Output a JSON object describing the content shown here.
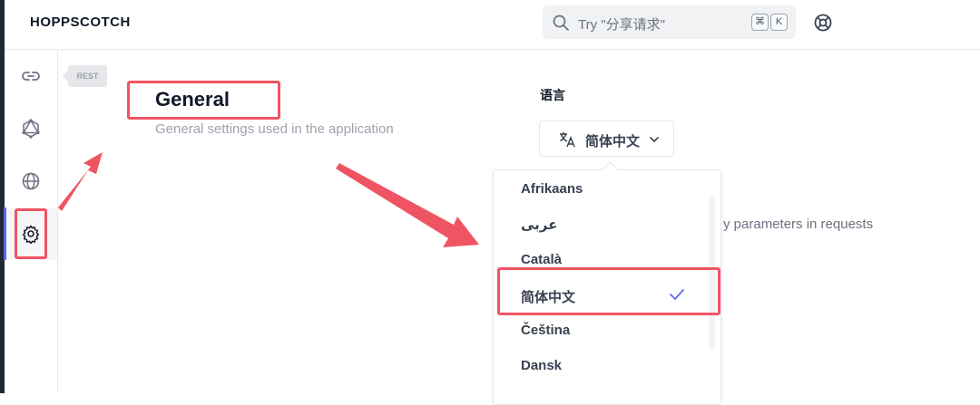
{
  "app": {
    "brand": "HOPPSCOTCH"
  },
  "search": {
    "placeholder": "Try \"分享请求\"",
    "shortcut_key1": "⌘",
    "shortcut_key2": "K"
  },
  "sidebar": {
    "tooltip": "REST",
    "items": [
      {
        "name": "rest",
        "icon": "link-icon"
      },
      {
        "name": "graphql",
        "icon": "graphql-icon"
      },
      {
        "name": "realtime",
        "icon": "globe-icon"
      },
      {
        "name": "settings",
        "icon": "gear-icon",
        "active": true
      }
    ]
  },
  "general": {
    "title": "General",
    "subtitle": "General settings used in the application"
  },
  "language": {
    "label": "语言",
    "selected": "简体中文",
    "options": [
      "Afrikaans",
      "عربى",
      "Català",
      "简体中文",
      "Čeština",
      "Dansk"
    ]
  },
  "background_text": "y parameters in requests",
  "colors": {
    "accent": "#6366f1",
    "annotation": "#ef5462"
  }
}
